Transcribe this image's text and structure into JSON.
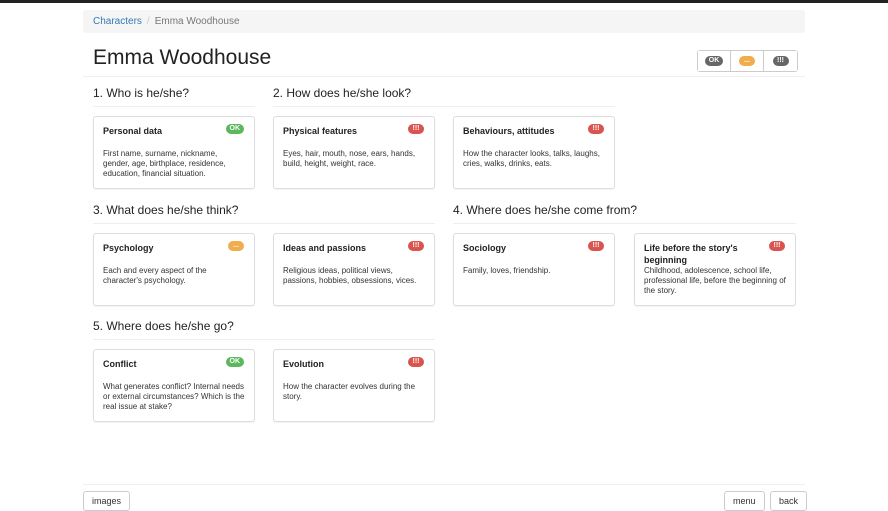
{
  "breadcrumb": {
    "parent": "Characters",
    "current": "Emma Woodhouse"
  },
  "title": "Emma Woodhouse",
  "filters": [
    {
      "label": "OK",
      "cls": "ok"
    },
    {
      "label": "...",
      "cls": "warn"
    },
    {
      "label": "!!!",
      "cls": "err"
    }
  ],
  "sections": [
    {
      "title": "1. Who is he/she?"
    },
    {
      "title": "2. How does he/she look?"
    },
    {
      "title": "3. What does he/she think?"
    },
    {
      "title": "4. Where does he/she come from?"
    },
    {
      "title": "5. Where does he/she go?"
    }
  ],
  "cards": [
    {
      "title": "Personal data",
      "status": "OK",
      "desc": "First name, surname, nickname, gender, age, birthplace, residence, education, financial situation."
    },
    {
      "title": "Physical features",
      "status": "!!!",
      "desc": "Eyes, hair, mouth, nose, ears, hands, build, height, weight, race."
    },
    {
      "title": "Behaviours, attitudes",
      "status": "!!!",
      "desc": "How the character looks, talks, laughs, cries, walks, drinks, eats."
    },
    {
      "title": "Psychology",
      "status": "...",
      "desc": "Each and every aspect of the character's psychology."
    },
    {
      "title": "Ideas and passions",
      "status": "!!!",
      "desc": "Religious ideas, political views, passions, hobbies, obsessions, vices."
    },
    {
      "title": "Sociology",
      "status": "!!!",
      "desc": "Family, loves, friendship."
    },
    {
      "title": "Life before the story's beginning",
      "status": "!!!",
      "desc": "Childhood, adolescence, school life, professional life, before the beginning of the story."
    },
    {
      "title": "Conflict",
      "status": "OK",
      "desc": "What generates conflict? Internal needs or external circumstances? Which is the real issue at stake?"
    },
    {
      "title": "Evolution",
      "status": "!!!",
      "desc": "How the character evolves during the story."
    }
  ],
  "footer": {
    "left": "images",
    "right1": "menu",
    "right2": "back"
  }
}
